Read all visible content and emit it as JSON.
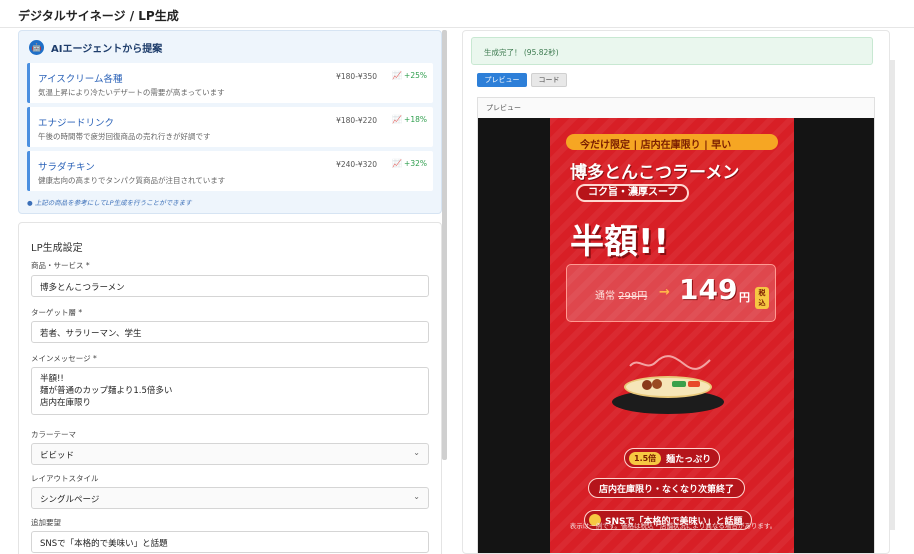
{
  "header": {
    "title": "デジタルサイネージ / LP生成"
  },
  "ai_panel": {
    "title": "AIエージェントから提案",
    "suggestions": [
      {
        "name": "アイスクリーム各種",
        "price": "¥180-¥350",
        "trend": "+25%",
        "desc": "気温上昇により冷たいデザートの需要が高まっています"
      },
      {
        "name": "エナジードリンク",
        "price": "¥180-¥220",
        "trend": "+18%",
        "desc": "午後の時間帯で疲労回復商品の売れ行きが好調です"
      },
      {
        "name": "サラダチキン",
        "price": "¥240-¥320",
        "trend": "+32%",
        "desc": "健康志向の高まりでタンパク質商品が注目されています"
      }
    ],
    "note": "上記の商品を参考にしてLP生成を行うことができます"
  },
  "lp_form": {
    "title": "LP生成設定",
    "product_label": "商品・サービス *",
    "product_value": "博多とんこつラーメン",
    "target_label": "ターゲット層 *",
    "target_value": "若者、サラリーマン、学生",
    "message_label": "メインメッセージ *",
    "message_lines": [
      "半額!!",
      "麺が普通のカップ麺より1.5倍多い",
      "店内在庫限り"
    ],
    "color_label": "カラーテーマ",
    "color_value": "ビビッド",
    "layout_label": "レイアウトスタイル",
    "layout_value": "シングルページ",
    "extra_label": "追加要望",
    "extra_value": "SNSで「本格的で美味い」と話題"
  },
  "result": {
    "status": "生成完了！ (95.82秒)",
    "tab_preview": "プレビュー",
    "tab_code": "コード",
    "preview_label": "プレビュー"
  },
  "poster": {
    "top_banner": "今だけ限定 | 店内在庫限り | 早い",
    "title": "博多とんこつラーメン",
    "subtitle": "コク旨・濃厚スープ",
    "big": "半額!!",
    "regular_label": "通常",
    "regular_price": "298円",
    "price": "149",
    "yen": "円",
    "tax_1": "税",
    "tax_2": "込",
    "pill_badge": "1.5倍",
    "pill_1": "麺たっぷり",
    "pill_2": "店内在庫限り・なくなり次第終了",
    "pill_3": "SNSで「本格的で美味い」と話題",
    "disclaimer": "表示は一例です。価格は税込・店舗状況により異なる場合があります。"
  },
  "colors": {
    "accent": "#2d7fd8",
    "poster_red": "#d81f26",
    "success_bg": "#eaf7ee",
    "trend_green": "#2e9e4d"
  }
}
